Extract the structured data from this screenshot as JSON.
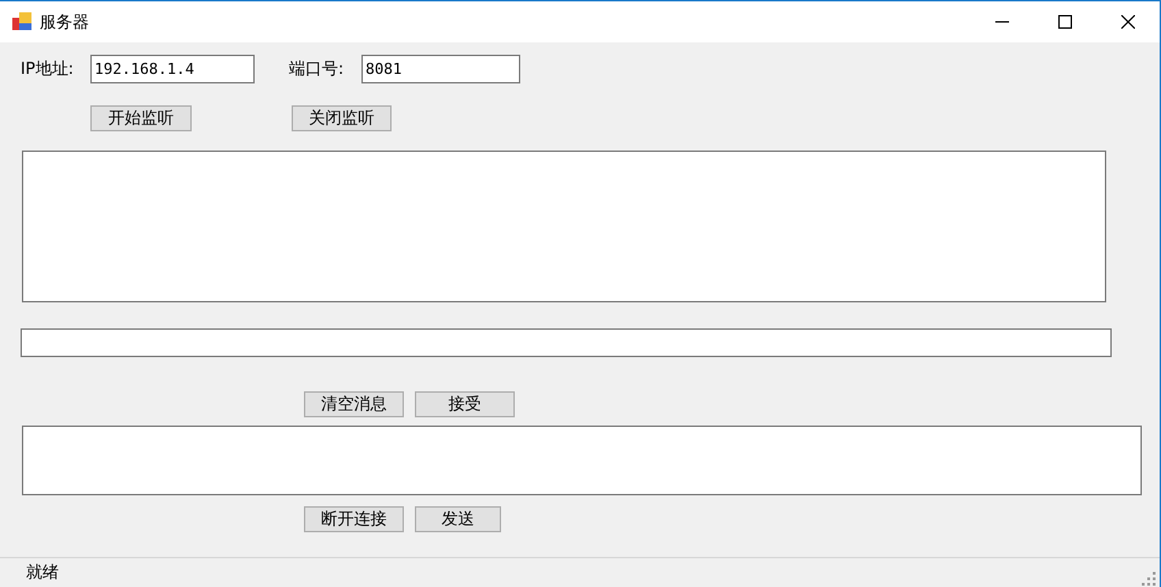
{
  "window": {
    "title": "服务器"
  },
  "ip": {
    "label": "IP地址:",
    "value": "192.168.1.4"
  },
  "port": {
    "label": "端口号:",
    "value": "8081"
  },
  "listen_buttons": [
    "开始监听",
    "关闭监听"
  ],
  "message_buttons": [
    "清空消息",
    "接受"
  ],
  "send_buttons": [
    "断开连接",
    "发送"
  ],
  "status_bar": {
    "text": "就绪"
  }
}
